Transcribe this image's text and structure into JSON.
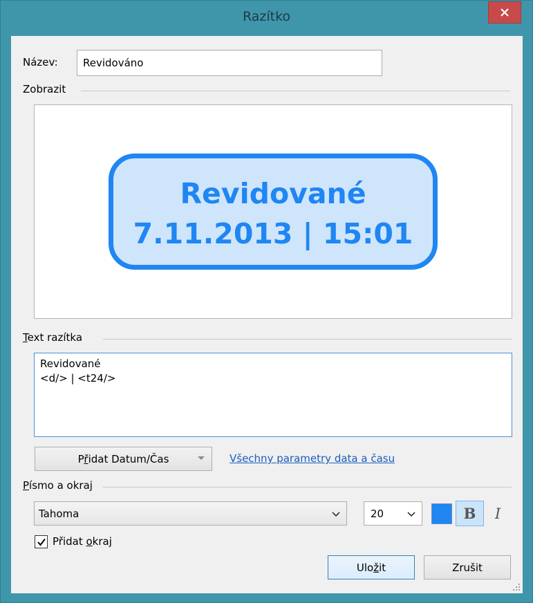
{
  "window": {
    "title": "Razítko",
    "close_glyph": "×"
  },
  "name": {
    "label": "Název:",
    "value": "Revidováno"
  },
  "preview": {
    "section_label": "Zobrazit",
    "stamp_line1": "Revidované",
    "stamp_line2": "7.11.2013 | 15:01",
    "stamp_color": "#1f86f2",
    "stamp_fill": "#cfe5fb"
  },
  "stamp_text": {
    "section_label_first": "T",
    "section_label_rest": "ext razítka",
    "line1": "Revidované",
    "line2": "<d/> | <t24/>"
  },
  "datetime": {
    "button_prefix": "P",
    "button_accel": "ř",
    "button_rest": "idat Datum/Čas",
    "link": "Všechny parametry data a času"
  },
  "font_border": {
    "section_label_first": "P",
    "section_label_rest": "ísmo a okraj",
    "font_name": "Tahoma",
    "font_size": "20",
    "color": "#1f86f2",
    "bold_label": "B",
    "italic_label": "I",
    "add_border_prefix": "Přidat ",
    "add_border_accel": "o",
    "add_border_rest": "kraj",
    "add_border_checked": true
  },
  "buttons": {
    "save_prefix": "Ulo",
    "save_accel": "ž",
    "save_rest": "it",
    "cancel": "Zrušit"
  }
}
